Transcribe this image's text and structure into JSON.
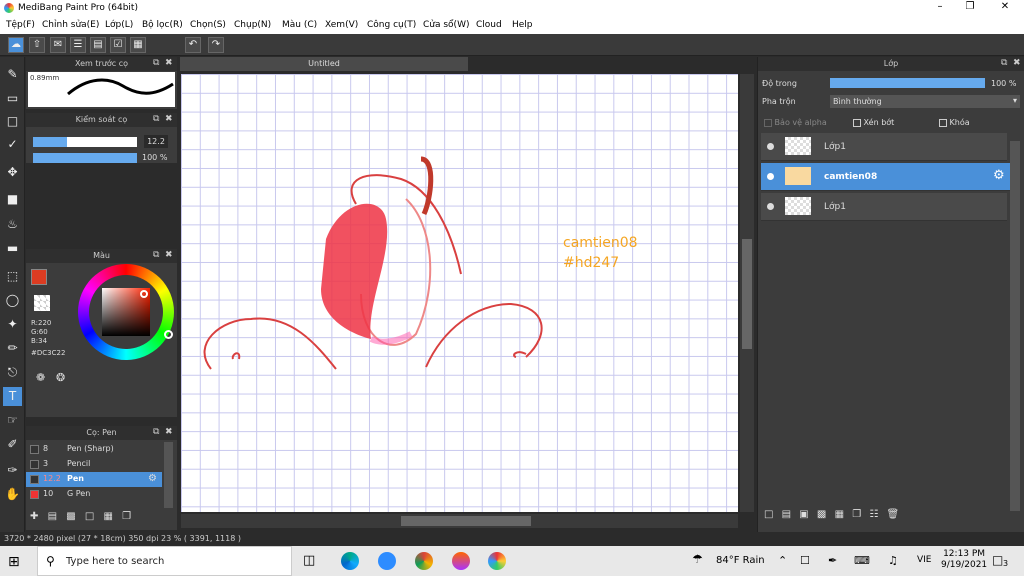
{
  "window": {
    "title": "MediBang Paint Pro (64bit)"
  },
  "menu": [
    "Tệp(F)",
    "Chỉnh sửa(E)",
    "Lớp(L)",
    "Bộ lọc(R)",
    "Chọn(S)",
    "Chụp(N)",
    "Màu (C)",
    "Xem(V)",
    "Công cụ(T)",
    "Cửa sổ(W)",
    "Cloud",
    "Help"
  ],
  "brush_preview": {
    "title": "Xem trước cọ",
    "size_label": "0.89mm"
  },
  "brush_control": {
    "title": "Kiểm soát cọ",
    "size": "12.2",
    "opacity": "100 %",
    "size_fill": 0.33,
    "opacity_fill": 1.0
  },
  "color_panel": {
    "title": "Màu",
    "r": "R:220",
    "g": "G:60",
    "b": "B:34",
    "hex": "#DC3C22",
    "fg_color": "#DC3C22"
  },
  "brush_list": {
    "title": "Cọ: Pen",
    "items": [
      {
        "size": "8",
        "name": "Pen (Sharp)"
      },
      {
        "size": "3",
        "name": "Pencil"
      },
      {
        "size": "12.2",
        "name": "Pen",
        "selected": true
      },
      {
        "size": "10",
        "name": "G Pen"
      }
    ]
  },
  "document": {
    "tab": "Untitled"
  },
  "canvas_text": {
    "line1": "camtien08",
    "line2": "#hd247",
    "color": "#f5a623"
  },
  "layer_panel": {
    "title": "Lớp",
    "opacity_label": "Độ trong",
    "opacity_value": "100 %",
    "opacity_fill": 1.0,
    "blend_label": "Pha trộn",
    "blend_value": "Bình thường",
    "protect_alpha": "Bảo vệ alpha",
    "clipping": "Xén bớt",
    "lock": "Khóa",
    "layers": [
      {
        "name": "Lớp1",
        "selected": false
      },
      {
        "name": "camtien08",
        "selected": true
      },
      {
        "name": "Lớp1",
        "selected": false
      }
    ]
  },
  "status": {
    "text": "3720 * 2480 pixel   (27 * 18cm)   350 dpi   23 %   ( 3391, 1118 )"
  },
  "taskbar": {
    "search_placeholder": "Type here to search",
    "weather": "84°F  Rain",
    "lang": "VIE",
    "time": "12:13 PM",
    "date": "9/19/2021",
    "notif_count": "3"
  }
}
